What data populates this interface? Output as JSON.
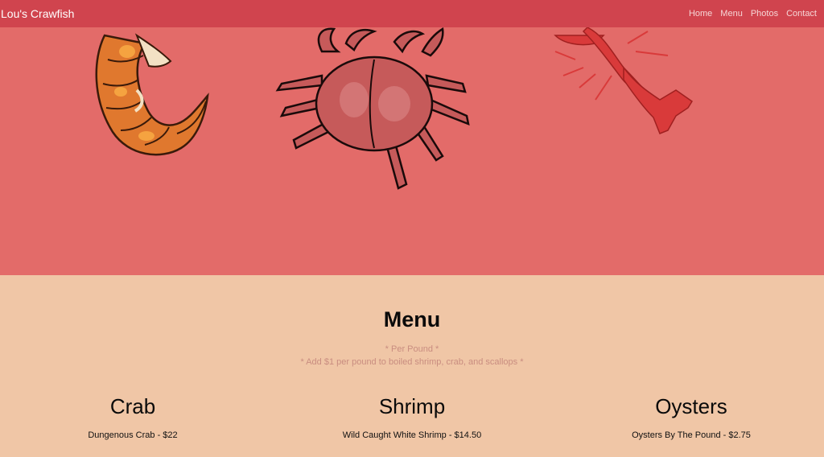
{
  "nav": {
    "brand": "Lou's Crawfish",
    "links": [
      "Home",
      "Menu",
      "Photos",
      "Contact"
    ]
  },
  "hero": {
    "icons": [
      "shrimp-icon",
      "crab-icon",
      "crawfish-icon"
    ],
    "colors": {
      "background": "#e36b69",
      "shrimp": "#e0782e",
      "crab": "#c65a5a",
      "crawfish": "#d93a3a"
    }
  },
  "menu": {
    "title": "Menu",
    "notes": [
      "* Per Pound *",
      "* Add $1 per pound to boiled shrimp, crab, and scallops *"
    ],
    "categories": [
      {
        "name": "Crab",
        "items": [
          "Dungenous Crab - $22"
        ]
      },
      {
        "name": "Shrimp",
        "items": [
          "Wild Caught White Shrimp - $14.50"
        ]
      },
      {
        "name": "Oysters",
        "items": [
          "Oysters By The Pound - $2.75"
        ]
      }
    ]
  },
  "colors": {
    "navbar": "#d0444e",
    "menu_background": "#f0c6a6"
  }
}
